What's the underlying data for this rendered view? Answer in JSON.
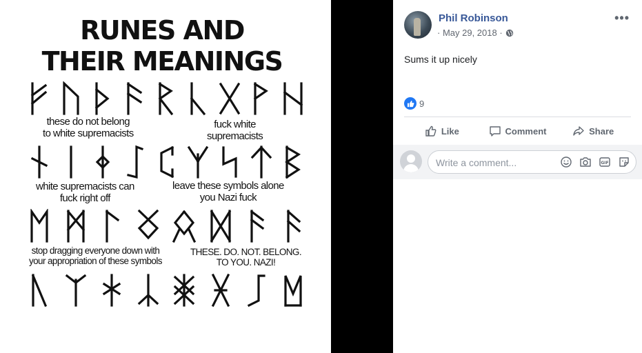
{
  "image": {
    "title_line1": "RUNES AND",
    "title_line2": "THEIR MEANINGS",
    "captions": {
      "row1_left": "these do not belong\nto white supremacists",
      "row1_right": "fuck white\nsupremacists",
      "row2_left": "white supremacists can\nfuck right off",
      "row2_right": "leave these symbols alone\nyou Nazi fuck",
      "row3_left": "stop dragging everyone down with\nyour appropriation of these symbols",
      "row3_right": "THESE. DO. NOT. BELONG.\nTO YOU. NAZI!"
    }
  },
  "post": {
    "author": "Phil Robinson",
    "date": "· May 29, 2018 ·",
    "privacy_icon": "globe-icon",
    "more_label": "•••",
    "text": "Sums it up nicely",
    "reaction_count": "9",
    "actions": {
      "like": "Like",
      "comment": "Comment",
      "share": "Share"
    },
    "comment_placeholder": "Write a comment..."
  },
  "colors": {
    "author_link": "#385898",
    "like_blue": "#2078f4",
    "muted_text": "#606770",
    "comment_bg": "#f2f3f5"
  }
}
